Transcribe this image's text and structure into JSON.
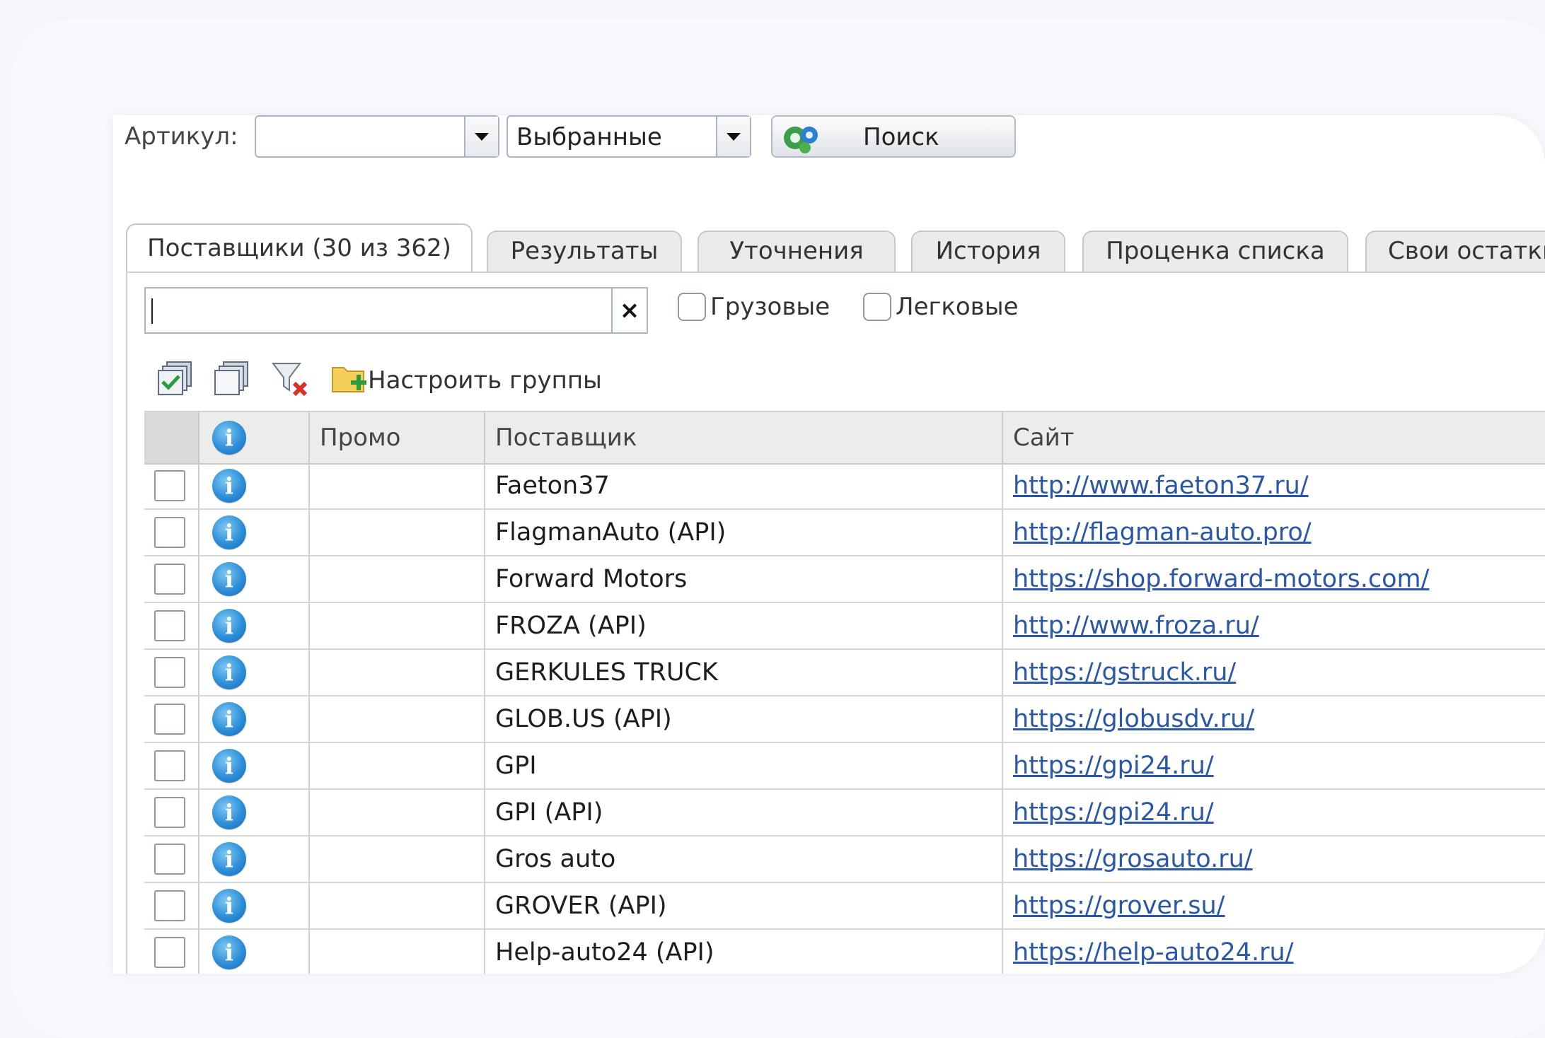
{
  "toolbar": {
    "article_label": "Артикул:",
    "article_value": "",
    "scope_value": "Выбранные",
    "search_label": "Поиск"
  },
  "tabs": [
    {
      "label": "Поставщики (30 из 362)",
      "active": true
    },
    {
      "label": "Результаты",
      "active": false
    },
    {
      "label": "Уточнения",
      "active": false
    },
    {
      "label": "История",
      "active": false
    },
    {
      "label": "Проценка списка",
      "active": false
    },
    {
      "label": "Свои остатки",
      "active": false
    }
  ],
  "filters": {
    "search_value": "",
    "clear_label": "×",
    "trucks_label": "Грузовые",
    "trucks_checked": false,
    "cars_label": "Легковые",
    "cars_checked": false
  },
  "groups": {
    "configure_label": "Настроить группы",
    "icons": [
      "select-all-icon",
      "deselect-all-icon",
      "clear-filter-icon",
      "folder-add-icon"
    ]
  },
  "table": {
    "columns": {
      "info": "i",
      "promo": "Промо",
      "supplier": "Поставщик",
      "site": "Сайт"
    },
    "rows": [
      {
        "supplier": "Faeton37",
        "site": "http://www.faeton37.ru/",
        "promo": "",
        "checked": false
      },
      {
        "supplier": "FlagmanAuto (API)",
        "site": "http://flagman-auto.pro/",
        "promo": "",
        "checked": false
      },
      {
        "supplier": "Forward Motors",
        "site": "https://shop.forward-motors.com/",
        "promo": "",
        "checked": false
      },
      {
        "supplier": "FROZA (API)",
        "site": "http://www.froza.ru/",
        "promo": "",
        "checked": false
      },
      {
        "supplier": "GERKULES TRUCK",
        "site": "https://gstruck.ru/",
        "promo": "",
        "checked": false
      },
      {
        "supplier": "GLOB.US (API)",
        "site": "https://globusdv.ru/",
        "promo": "",
        "checked": false
      },
      {
        "supplier": "GPI",
        "site": "https://gpi24.ru/",
        "promo": "",
        "checked": false
      },
      {
        "supplier": "GPI (API)",
        "site": "https://gpi24.ru/",
        "promo": "",
        "checked": false
      },
      {
        "supplier": "Gros auto",
        "site": "https://grosauto.ru/",
        "promo": "",
        "checked": false
      },
      {
        "supplier": "GROVER (API)",
        "site": "https://grover.su/",
        "promo": "",
        "checked": false
      },
      {
        "supplier": "Help-auto24 (API)",
        "site": "https://help-auto24.ru/",
        "promo": "",
        "checked": false
      }
    ]
  },
  "colors": {
    "link": "#2a57a8",
    "header_bg": "#ececea",
    "info_icon": "#2d8fd8"
  }
}
